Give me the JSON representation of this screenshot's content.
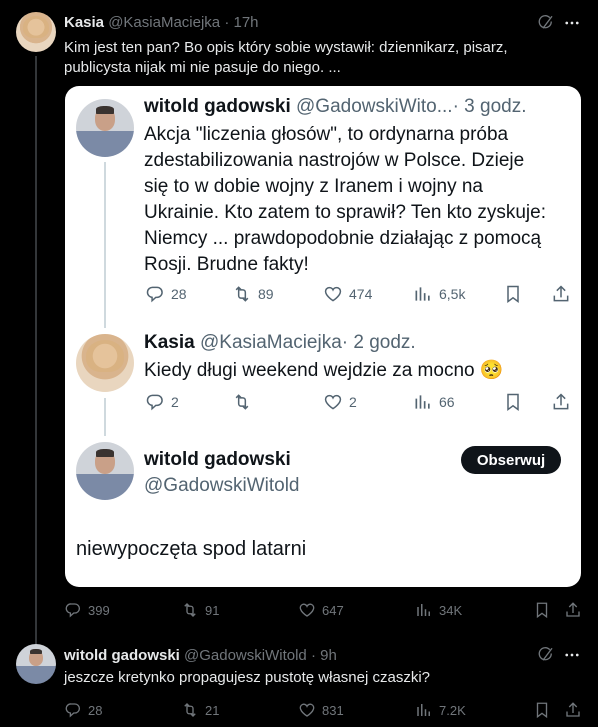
{
  "top_tweet": {
    "author": "Kasia",
    "handle": "@KasiaMaciejka",
    "time": "· 17h",
    "text_line1": "Kim jest ten pan? Bo opis który sobie wystawił: dziennikarz, pisarz,",
    "text_line2": "publicysta nijak mi nie pasuje do niego. ...",
    "replies": "399",
    "retweets": "91",
    "likes": "647",
    "views": "34K"
  },
  "embedded": {
    "tweet1": {
      "author": "witold gadowski",
      "handle": "@GadowskiWito...",
      "time": "· 3 godz.",
      "lines": [
        "Akcja \"liczenia głosów\", to ordynarna próba",
        "zdestabilizowania nastrojów w Polsce. Dzieje",
        "się to w dobie wojny z Iranem i wojny na",
        "Ukrainie. Kto zatem to sprawił? Ten kto zyskuje:",
        "Niemcy ... prawdopodobnie działając z pomocą",
        "Rosji. Brudne fakty!"
      ],
      "replies": "28",
      "retweets": "89",
      "likes": "474",
      "views": "6,5k"
    },
    "tweet2": {
      "author": "Kasia",
      "handle": "@KasiaMaciejka",
      "time": "· 2 godz.",
      "text": "Kiedy długi weekend wejdzie za mocno 🥺",
      "replies": "2",
      "retweets": "",
      "likes": "2",
      "views": "66"
    },
    "tweet3": {
      "author": "witold gadowski",
      "handle": "@GadowskiWitold",
      "follow_label": "Obserwuj",
      "text": "niewypoczęta spod latarni"
    }
  },
  "reply_tweet": {
    "author": "witold gadowski",
    "handle": "@GadowskiWitold",
    "time": "· 9h",
    "text": "jeszcze kretynko propagujesz pustotę własnej czaszki?",
    "replies": "28",
    "retweets": "21",
    "likes": "831",
    "views": "7.2K"
  },
  "colors": {
    "background": "#000000",
    "card": "#ffffff",
    "muted": "#71767b"
  }
}
